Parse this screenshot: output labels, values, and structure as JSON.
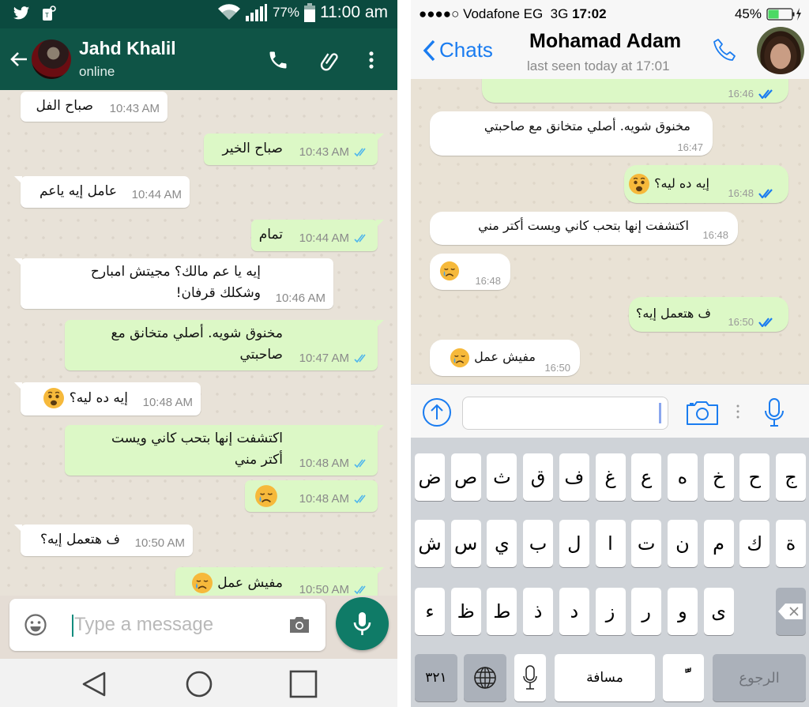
{
  "android": {
    "status_bar": {
      "left_icons": [
        "twitter-icon",
        "sim-tag-icon"
      ],
      "battery_pct": "77%",
      "time": "11:00 am"
    },
    "header": {
      "contact_name": "Jahd Khalil",
      "status": "online",
      "actions": [
        "call-icon",
        "attach-icon",
        "more-icon"
      ]
    },
    "messages": [
      {
        "dir": "in",
        "text": "صباح الفل",
        "time": "10:43 AM"
      },
      {
        "dir": "out",
        "text": "صباح الخير",
        "time": "10:43 AM",
        "ticks": "read"
      },
      {
        "dir": "in",
        "text": "عامل إيه ياعم",
        "time": "10:44 AM"
      },
      {
        "dir": "out",
        "text": "تمام",
        "time": "10:44 AM",
        "ticks": "read"
      },
      {
        "dir": "in",
        "line1": "إيه يا عم مالك؟ مجيتش امبارح",
        "line2": "وشكلك قرفان!",
        "time": "10:46 AM"
      },
      {
        "dir": "out",
        "line1": "مخنوق شويه. أصلي متخانق مع",
        "line2": "صاحبتي",
        "time": "10:47 AM",
        "ticks": "read"
      },
      {
        "dir": "in",
        "text": "إيه ده ليه؟",
        "emoji": "anguished-face",
        "time": "10:48 AM"
      },
      {
        "dir": "out",
        "line1": "اكتشفت إنها بتحب كاني ويست",
        "line2": "أكتر مني",
        "time": "10:48 AM",
        "ticks": "read"
      },
      {
        "dir": "out",
        "text": "",
        "emoji": "crying-face",
        "time": "10:48 AM",
        "ticks": "read"
      },
      {
        "dir": "in",
        "text": "ف هتعمل إيه؟",
        "time": "10:50 AM"
      },
      {
        "dir": "out",
        "text": "مفيش عمل",
        "emoji": "crying-face",
        "time": "10:50 AM",
        "ticks": "read"
      }
    ],
    "input": {
      "placeholder": "Type a message",
      "value": ""
    },
    "nav": [
      "back",
      "home",
      "recents"
    ]
  },
  "ios": {
    "status_bar": {
      "signal": "●●●●○",
      "carrier": "Vodafone EG",
      "network": "3G",
      "time": "17:02",
      "battery_pct": "45%",
      "battery_level": 0.45
    },
    "header": {
      "back_label": "Chats",
      "contact_name": "Mohamad Adam",
      "last_seen": "last seen today at 17:01"
    },
    "messages": [
      {
        "dir": "out",
        "text": "",
        "time": "16:46",
        "ticks": "read",
        "partial": true
      },
      {
        "dir": "in",
        "text": "مخنوق شويه. أصلي متخانق مع صاحبتي",
        "time": "16:47"
      },
      {
        "dir": "out",
        "text": "إيه ده ليه؟",
        "emoji": "anguished-face",
        "time": "16:48",
        "ticks": "read"
      },
      {
        "dir": "in",
        "text": "اكتشفت إنها بتحب كاني ويست أكتر مني",
        "time": "16:48"
      },
      {
        "dir": "in",
        "text": "",
        "emoji": "crying-face",
        "time": "16:48"
      },
      {
        "dir": "out",
        "text": "ف هتعمل إيه؟",
        "time": "16:50",
        "ticks": "read"
      },
      {
        "dir": "in",
        "text": "مفيش عمل",
        "emoji": "crying-face",
        "time": "16:50"
      }
    ],
    "input": {
      "value": "",
      "placeholder": ""
    },
    "keyboard": {
      "row1": [
        "ض",
        "ص",
        "ث",
        "ق",
        "ف",
        "غ",
        "ع",
        "ه",
        "خ",
        "ح",
        "ج"
      ],
      "row2": [
        "ش",
        "س",
        "ي",
        "ب",
        "ل",
        "ا",
        "ت",
        "ن",
        "م",
        "ك",
        "ة"
      ],
      "row3": [
        "ء",
        "ظ",
        "ط",
        "ذ",
        "د",
        "ز",
        "ر",
        "و",
        "ى"
      ],
      "numbers_label": "٣٢١",
      "space_label": "مسافة",
      "diacritic_label": "ًّ",
      "return_label": "الرجوع"
    }
  },
  "colors": {
    "android_header": "#0f5446",
    "android_status": "#0b4a3f",
    "outgoing_bubble": "#dcf8c6",
    "incoming_bubble": "#ffffff",
    "android_mic": "#0f7b67",
    "ios_accent": "#1a7cf0",
    "read_tick_android": "#4fb6ec",
    "read_tick_ios": "#1a7cf0"
  }
}
